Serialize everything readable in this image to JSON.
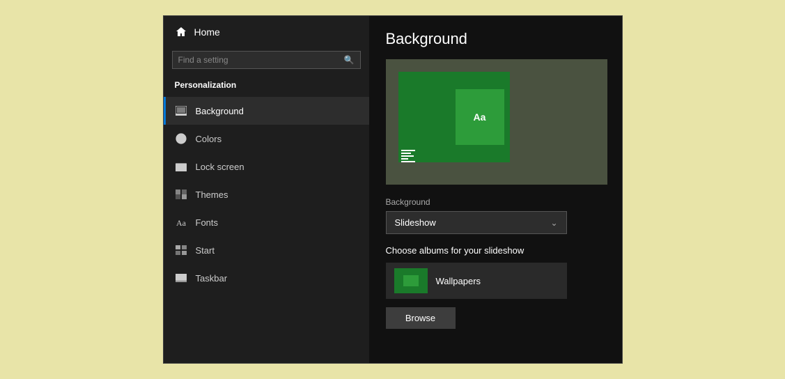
{
  "sidebar": {
    "home_label": "Home",
    "search_placeholder": "Find a setting",
    "section_label": "Personalization",
    "nav_items": [
      {
        "id": "background",
        "label": "Background",
        "active": true
      },
      {
        "id": "colors",
        "label": "Colors",
        "active": false
      },
      {
        "id": "lock-screen",
        "label": "Lock screen",
        "active": false
      },
      {
        "id": "themes",
        "label": "Themes",
        "active": false
      },
      {
        "id": "fonts",
        "label": "Fonts",
        "active": false
      },
      {
        "id": "start",
        "label": "Start",
        "active": false
      },
      {
        "id": "taskbar",
        "label": "Taskbar",
        "active": false
      }
    ]
  },
  "main": {
    "title": "Background",
    "bg_label": "Background",
    "dropdown_value": "Slideshow",
    "choose_label": "Choose albums for your slideshow",
    "wallpaper_name": "Wallpapers",
    "browse_label": "Browse"
  },
  "preview": {
    "sample_text": "Aa"
  }
}
